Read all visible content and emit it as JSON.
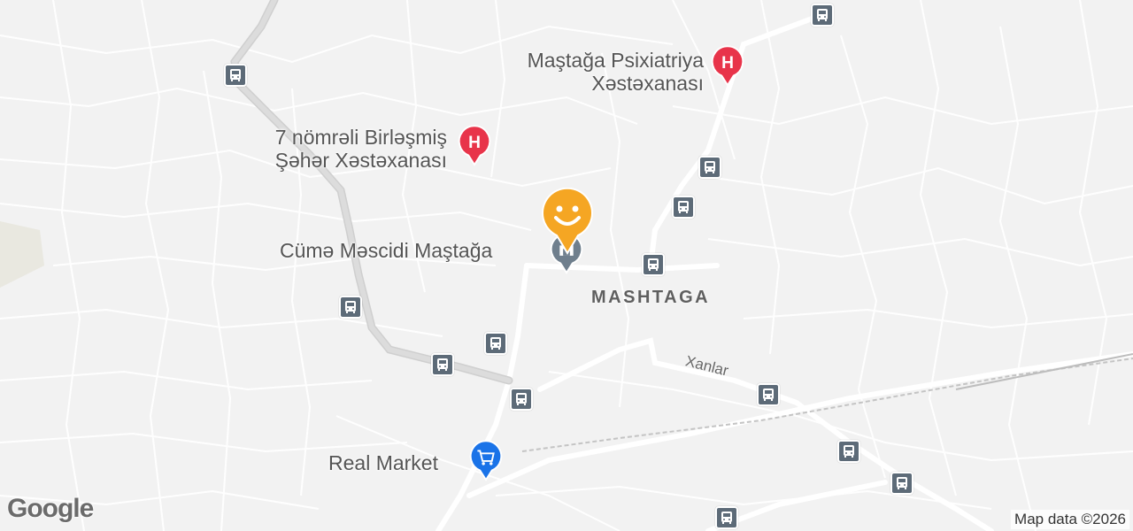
{
  "map": {
    "area_label": "MASHTAGA",
    "street_label": "Xanlar",
    "attribution": "Map data ©2026",
    "logo": "Google"
  },
  "places": [
    {
      "id": "hospital1",
      "line1": "Maştağa Psixiatriya",
      "line2": "Xəstəxanası",
      "icon": "hospital-icon"
    },
    {
      "id": "hospital2",
      "line1": "7 nömrəli Birləşmiş",
      "line2": "Şəhər Xəstəxanası",
      "icon": "hospital-icon"
    },
    {
      "id": "mosque",
      "line1": "Cümə Məscidi Maştağa",
      "icon": "mosque-icon"
    },
    {
      "id": "market",
      "line1": "Real Market",
      "icon": "shopping-cart-icon"
    }
  ],
  "colors": {
    "hospital": "#e8344a",
    "market": "#1a73e8",
    "transit": "#5d6b78",
    "location_marker": "#f5a623"
  }
}
